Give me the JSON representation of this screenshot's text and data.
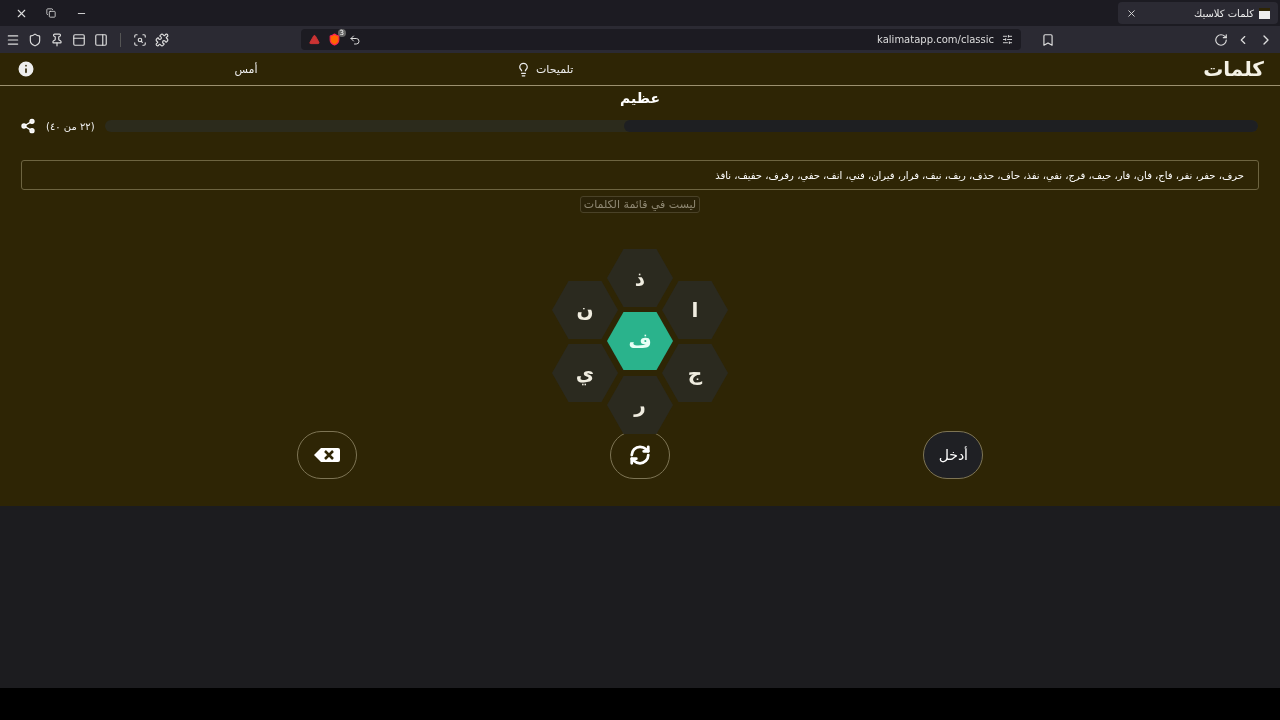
{
  "browser": {
    "tab_title": "كلمات كلاسيك",
    "url": "kalimatapp.com/classic",
    "shields_count": "3"
  },
  "header": {
    "logo": "كلمات",
    "hints": "تلميحات",
    "yesterday": "أمس"
  },
  "rank": "عظيم",
  "progress": {
    "label": "(٢٢ من ٤٠)",
    "level": 0.55
  },
  "found_words": "حرف، حفر، نفر، فاج، فان، فار، حيف، فرج، نفي، نفذ، حاف، حذف، ريف، نيف، فرار، فيران، فني، انف، حفي، رفرف، حفيف، نافذ",
  "message": "ليست في قائمة الكلمات",
  "letters": [
    {
      "letter": "ذ",
      "kind": "outer"
    },
    {
      "letter": "ن",
      "kind": "outer"
    },
    {
      "letter": "ا",
      "kind": "outer"
    },
    {
      "letter": "ف",
      "kind": "center"
    },
    {
      "letter": "ي",
      "kind": "outer"
    },
    {
      "letter": "ج",
      "kind": "outer"
    },
    {
      "letter": "ر",
      "kind": "outer"
    }
  ],
  "buttons": [
    {
      "kind": "delete"
    },
    {
      "kind": "shuffle"
    },
    {
      "kind": "enter",
      "label": "أدخل"
    }
  ]
}
